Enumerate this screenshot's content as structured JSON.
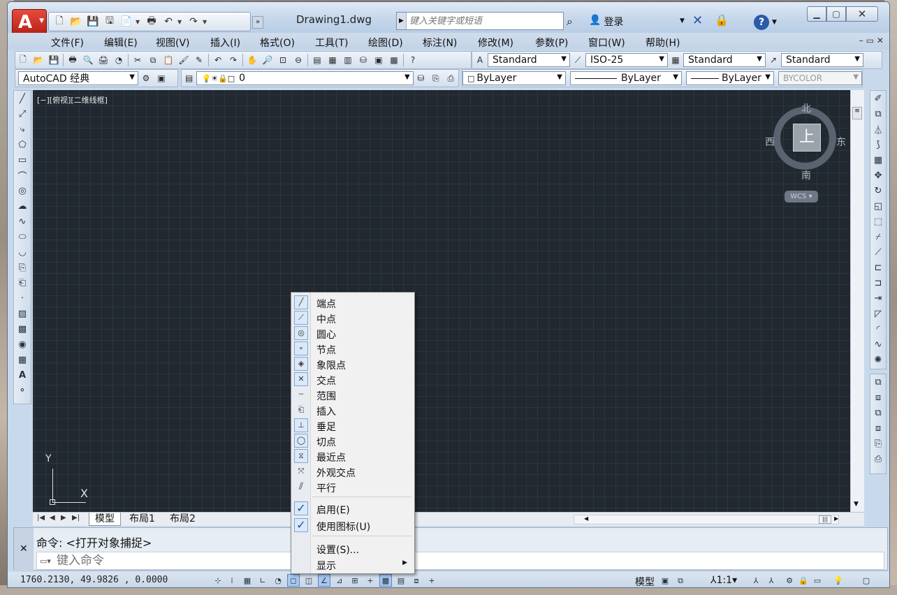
{
  "titlebar": {
    "document_title": "Drawing1.dwg",
    "search_placeholder": "键入关键字或短语",
    "login_label": "登录",
    "min_icon": "minimize-icon",
    "max_icon": "maximize-icon",
    "close_icon": "close-icon"
  },
  "menu": {
    "items": [
      "文件(F)",
      "编辑(E)",
      "视图(V)",
      "插入(I)",
      "格式(O)",
      "工具(T)",
      "绘图(D)",
      "标注(N)",
      "修改(M)",
      "参数(P)",
      "窗口(W)",
      "帮助(H)"
    ]
  },
  "toolbars": {
    "text_style": "Standard",
    "dim_style": "ISO-25",
    "table_style": "Standard",
    "multileader_style": "Standard",
    "workspace": "AutoCAD 经典",
    "layer": "0",
    "color": "ByLayer",
    "linetype": "ByLayer",
    "lineweight": "ByLayer",
    "plot_style": "BYCOLOR"
  },
  "viewport": {
    "label": "[−][俯视][二维线框]",
    "viewcube_top": "上",
    "north": "北",
    "south": "南",
    "east": "东",
    "west": "西",
    "wcs": "WCS",
    "ucs_x": "X",
    "ucs_y": "Y"
  },
  "layout_tabs": [
    "模型",
    "布局1",
    "布局2"
  ],
  "command": {
    "history": "命令:  <打开对象捕捉>",
    "placeholder": "键入命令"
  },
  "status": {
    "coordinates": "1760.2130, 49.9826 , 0.0000",
    "model_label": "模型",
    "scale": "1:1"
  },
  "context_menu": {
    "snaps": [
      {
        "label": "端点",
        "icon": "endpoint-snap-icon"
      },
      {
        "label": "中点",
        "icon": "midpoint-snap-icon"
      },
      {
        "label": "圆心",
        "icon": "center-snap-icon"
      },
      {
        "label": "节点",
        "icon": "node-snap-icon"
      },
      {
        "label": "象限点",
        "icon": "quadrant-snap-icon"
      },
      {
        "label": "交点",
        "icon": "intersection-snap-icon"
      },
      {
        "label": "范围",
        "icon": "extension-snap-icon"
      },
      {
        "label": "插入",
        "icon": "insertion-snap-icon"
      },
      {
        "label": "垂足",
        "icon": "perpendicular-snap-icon"
      },
      {
        "label": "切点",
        "icon": "tangent-snap-icon"
      },
      {
        "label": "最近点",
        "icon": "nearest-snap-icon"
      },
      {
        "label": "外观交点",
        "icon": "apparent-intersection-snap-icon"
      },
      {
        "label": "平行",
        "icon": "parallel-snap-icon"
      }
    ],
    "enable": "启用(E)",
    "use_icons": "使用图标(U)",
    "settings": "设置(S)...",
    "display": "显示"
  }
}
